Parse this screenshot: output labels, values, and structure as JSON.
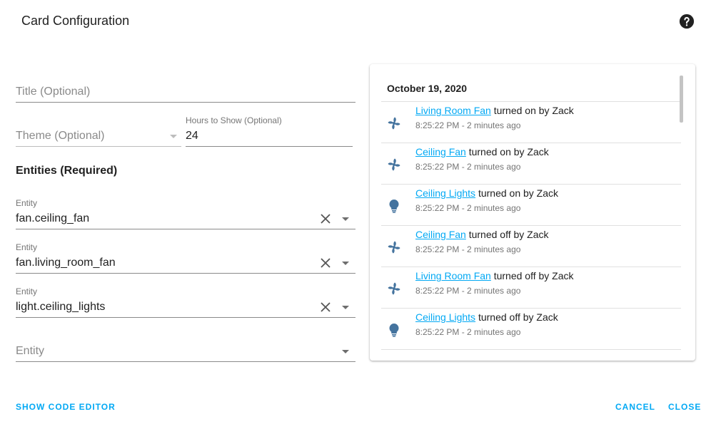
{
  "dialog": {
    "title": "Card Configuration",
    "help_icon": "help-circle-icon"
  },
  "form": {
    "title_field": {
      "placeholder": "Title (Optional)"
    },
    "theme_field": {
      "placeholder": "Theme (Optional)"
    },
    "hours_field": {
      "label": "Hours to Show (Optional)",
      "value": "24"
    },
    "entities_heading": "Entities (Required)",
    "entities": [
      {
        "label": "Entity",
        "value": "fan.ceiling_fan"
      },
      {
        "label": "Entity",
        "value": "fan.living_room_fan"
      },
      {
        "label": "Entity",
        "value": "light.ceiling_lights"
      }
    ],
    "new_entity": {
      "placeholder": "Entity"
    }
  },
  "preview": {
    "date": "October 19, 2020",
    "entries": [
      {
        "icon": "fan-icon",
        "name": "Living Room Fan",
        "action": " turned on by Zack",
        "time": "8:25:22 PM - 2 minutes ago"
      },
      {
        "icon": "fan-icon",
        "name": "Ceiling Fan",
        "action": " turned on by Zack",
        "time": "8:25:22 PM - 2 minutes ago"
      },
      {
        "icon": "lightbulb-icon",
        "name": "Ceiling Lights",
        "action": " turned on by Zack",
        "time": "8:25:22 PM - 2 minutes ago"
      },
      {
        "icon": "fan-icon",
        "name": "Ceiling Fan",
        "action": " turned off by Zack",
        "time": "8:25:22 PM - 2 minutes ago"
      },
      {
        "icon": "fan-icon",
        "name": "Living Room Fan",
        "action": " turned off by Zack",
        "time": "8:25:22 PM - 2 minutes ago"
      },
      {
        "icon": "lightbulb-icon",
        "name": "Ceiling Lights",
        "action": " turned off by Zack",
        "time": "8:25:22 PM - 2 minutes ago"
      }
    ]
  },
  "footer": {
    "code_editor": "SHOW CODE EDITOR",
    "cancel": "CANCEL",
    "close": "CLOSE"
  },
  "colors": {
    "accent": "#03a9f4",
    "icon": "#44739e",
    "text": "#212121",
    "muted": "#757575"
  }
}
